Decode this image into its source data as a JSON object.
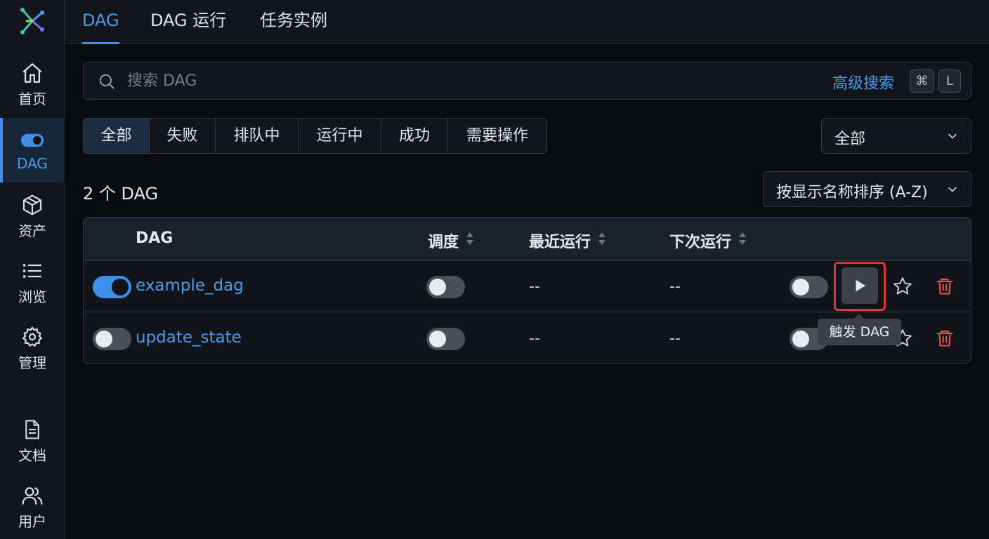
{
  "nav": {
    "items": [
      {
        "label": "首页",
        "icon": "home-icon"
      },
      {
        "label": "DAG",
        "icon": "dag-toggle-icon",
        "active": true
      },
      {
        "label": "资产",
        "icon": "asset-cube-icon"
      },
      {
        "label": "浏览",
        "icon": "list-icon"
      },
      {
        "label": "管理",
        "icon": "gear-icon"
      },
      {
        "label": "文档",
        "icon": "document-icon"
      },
      {
        "label": "用户",
        "icon": "users-icon"
      }
    ]
  },
  "tabs": [
    {
      "label": "DAG",
      "active": true
    },
    {
      "label": "DAG 运行"
    },
    {
      "label": "任务实例"
    }
  ],
  "search": {
    "placeholder": "搜索 DAG",
    "advanced_label": "高级搜索",
    "shortcut_keys": [
      "⌘",
      "L"
    ]
  },
  "filters": {
    "buttons": [
      "全部",
      "失败",
      "排队中",
      "运行中",
      "成功",
      "需要操作"
    ],
    "active": "全部",
    "select_value": "全部"
  },
  "list": {
    "count_text": "2 个 DAG",
    "sort_value": "按显示名称排序 (A-Z)",
    "columns": [
      "DAG",
      "调度",
      "最近运行",
      "下次运行"
    ],
    "rows": [
      {
        "name": "example_dag",
        "enabled": true,
        "schedule": false,
        "last_run": "--",
        "next_run": "--",
        "paused_toggle": false
      },
      {
        "name": "update_state",
        "enabled": false,
        "schedule": false,
        "last_run": "--",
        "next_run": "--",
        "paused_toggle": false
      }
    ]
  },
  "tooltip": {
    "text": "触发 DAG"
  },
  "colors": {
    "accent": "#4a9cf0",
    "danger": "#e5534b",
    "highlight": "#e0382b",
    "background": "#0a0b0e"
  }
}
